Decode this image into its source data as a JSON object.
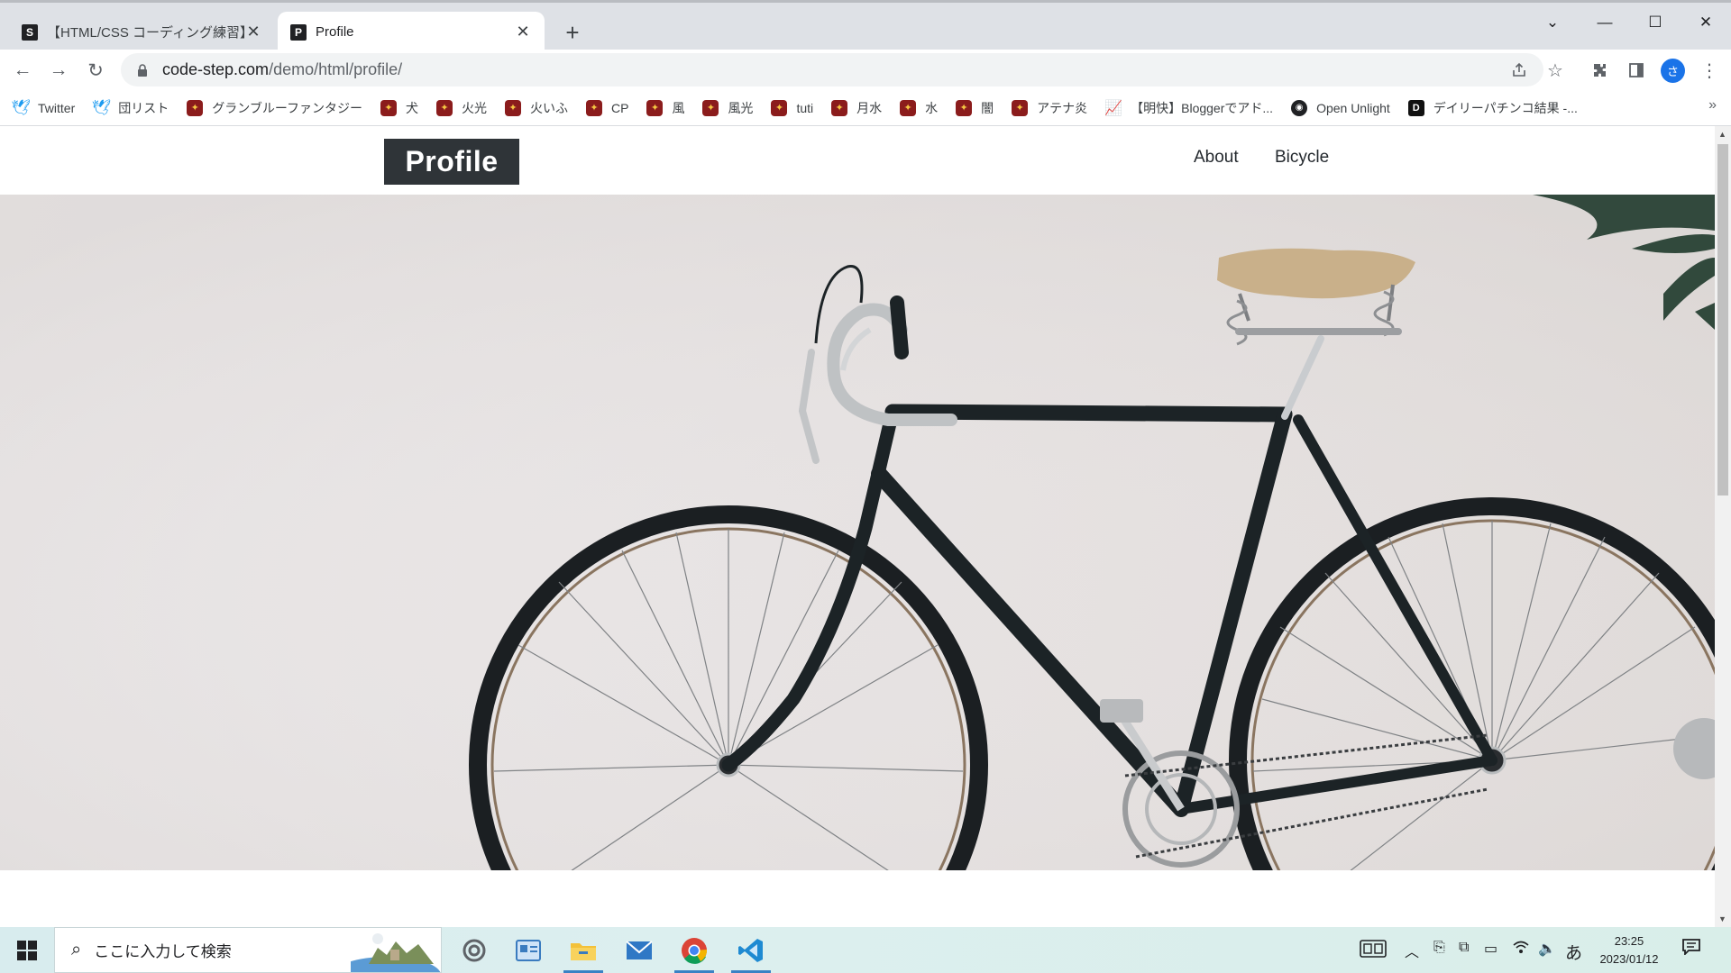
{
  "browser": {
    "tabs": [
      {
        "title": "【HTML/CSS コーディング練習】入門",
        "favicon": "S",
        "active": false
      },
      {
        "title": "Profile",
        "favicon": "P",
        "active": true
      }
    ],
    "new_tab_icon": "plus-icon",
    "url_domain": "code-step.com",
    "url_path": "/demo/html/profile/",
    "profile_initial": "さ"
  },
  "bookmarks": [
    {
      "label": "Twitter",
      "icon": "twitter-icon"
    },
    {
      "label": "団リスト",
      "icon": "twitter-icon"
    },
    {
      "label": "グランブルーファンタジー",
      "icon": "gbf-icon"
    },
    {
      "label": "犬",
      "icon": "gbf-icon"
    },
    {
      "label": "火光",
      "icon": "gbf-icon"
    },
    {
      "label": "火いふ",
      "icon": "gbf-icon"
    },
    {
      "label": "CP",
      "icon": "gbf-icon"
    },
    {
      "label": "風",
      "icon": "gbf-icon"
    },
    {
      "label": "風光",
      "icon": "gbf-icon"
    },
    {
      "label": "tuti",
      "icon": "gbf-icon"
    },
    {
      "label": "月水",
      "icon": "gbf-icon"
    },
    {
      "label": "水",
      "icon": "gbf-icon"
    },
    {
      "label": "闇",
      "icon": "gbf-icon"
    },
    {
      "label": "アテナ炎",
      "icon": "gbf-icon"
    },
    {
      "label": "【明快】Bloggerでアド...",
      "icon": "chart-icon"
    },
    {
      "label": "Open Unlight",
      "icon": "unlight-icon"
    },
    {
      "label": "デイリーパチンコ結果 -...",
      "icon": "d-icon"
    }
  ],
  "site": {
    "logo": "Profile",
    "nav": [
      "About",
      "Bicycle"
    ]
  },
  "taskbar": {
    "search_placeholder": "ここに入力して検索",
    "ime": "あ",
    "time": "23:25",
    "date": "2023/01/12"
  }
}
